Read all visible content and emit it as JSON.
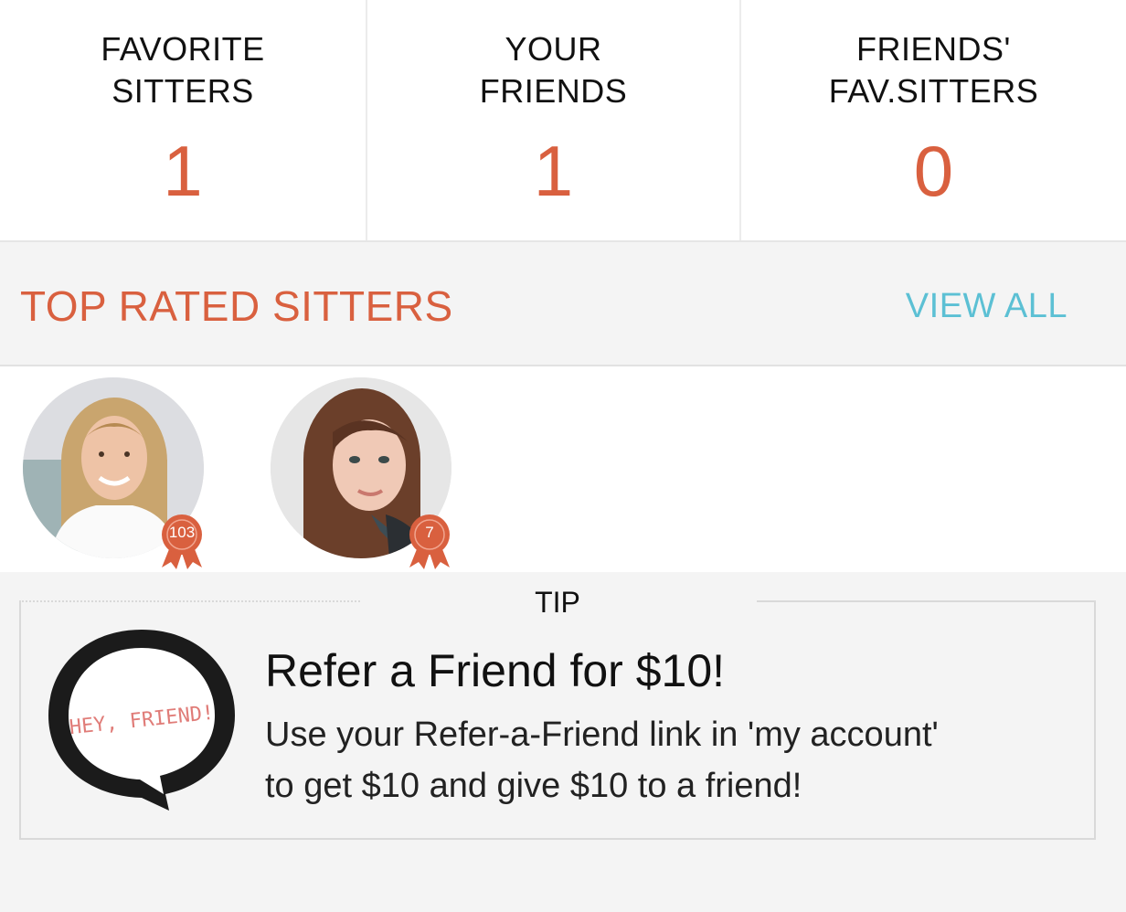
{
  "stats": [
    {
      "label": "FAVORITE\nSITTERS",
      "value": "1"
    },
    {
      "label": "YOUR\nFRIENDS",
      "value": "1"
    },
    {
      "label": "FRIENDS'\nFAV.SITTERS",
      "value": "0"
    }
  ],
  "top_rated": {
    "title": "TOP RATED SITTERS",
    "view_all": "VIEW ALL",
    "sitters": [
      {
        "badge_count": "103"
      },
      {
        "badge_count": "7"
      }
    ]
  },
  "tip": {
    "label": "TIP",
    "bubble_text": "HEY, FRIEND!",
    "title": "Refer a Friend for $10!",
    "body": "Use your Refer-a-Friend link in 'my account'\nto get $10 and give $10 to a friend!"
  },
  "colors": {
    "accent": "#d9603f",
    "link": "#5cc0d4",
    "background": "#f4f4f4"
  }
}
